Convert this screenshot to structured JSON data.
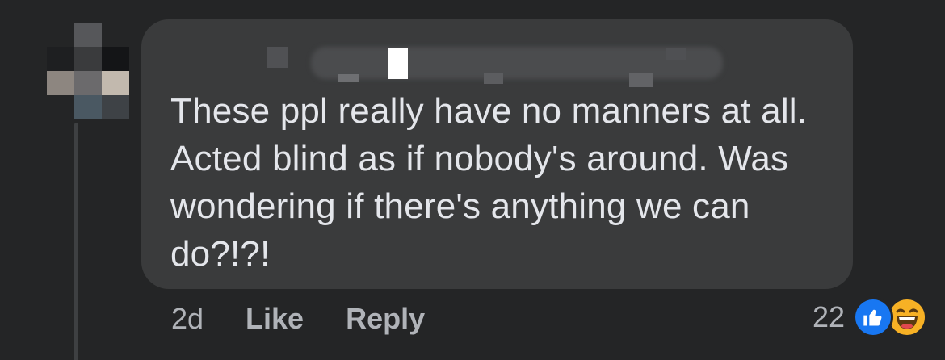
{
  "comment": {
    "author_name": "",
    "text": "These ppl really have no manners at all.\nActed blind as if nobody's around. Was\nwondering if there's anything we can\ndo?!?!"
  },
  "actions": {
    "time": "2d",
    "like_label": "Like",
    "reply_label": "Reply"
  },
  "reactions": {
    "count": "22",
    "icons": [
      "like-icon",
      "haha-icon"
    ]
  },
  "colors": {
    "background": "#242526",
    "bubble": "#3a3b3c",
    "text": "#e4e6eb",
    "secondary_text": "#b0b3b8",
    "like_blue": "#1877f2",
    "haha_yellow": "#f7b125"
  }
}
